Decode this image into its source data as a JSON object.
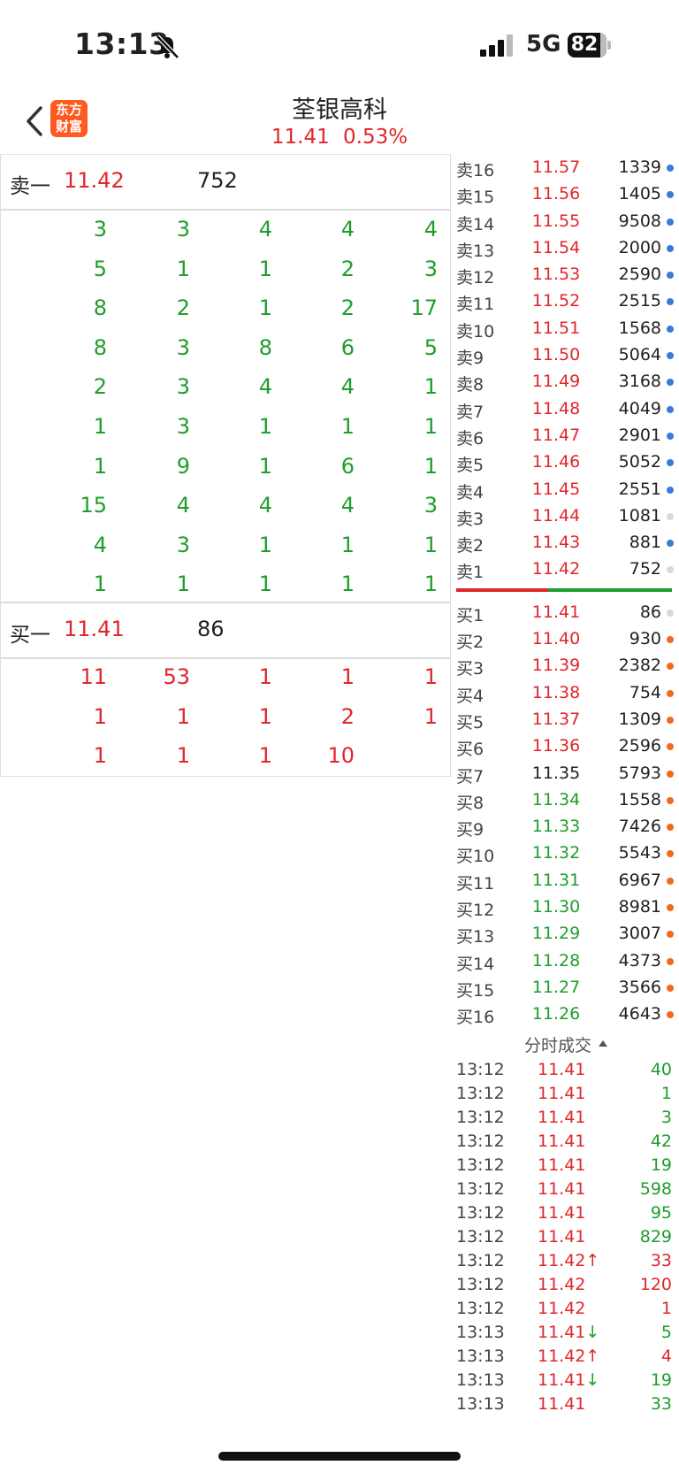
{
  "status_bar": {
    "time": "13:13",
    "network": "5G",
    "battery": "82"
  },
  "header": {
    "logo_text": "东方财富",
    "title": "荃银高科",
    "price": "11.41",
    "change": "0.53%"
  },
  "left_panel": {
    "sell1": {
      "label": "卖一",
      "price": "11.42",
      "volume": "752"
    },
    "sell_queue": [
      [
        "3",
        "3",
        "4",
        "4",
        "4"
      ],
      [
        "5",
        "1",
        "1",
        "2",
        "3"
      ],
      [
        "8",
        "2",
        "1",
        "2",
        "17"
      ],
      [
        "8",
        "3",
        "8",
        "6",
        "5"
      ],
      [
        "2",
        "3",
        "4",
        "4",
        "1"
      ],
      [
        "1",
        "3",
        "1",
        "1",
        "1"
      ],
      [
        "1",
        "9",
        "1",
        "6",
        "1"
      ],
      [
        "15",
        "4",
        "4",
        "4",
        "3"
      ],
      [
        "4",
        "3",
        "1",
        "1",
        "1"
      ],
      [
        "1",
        "1",
        "1",
        "1",
        "1"
      ]
    ],
    "buy1": {
      "label": "买一",
      "price": "11.41",
      "volume": "86"
    },
    "buy_queue": [
      [
        "11",
        "53",
        "1",
        "1",
        "1"
      ],
      [
        "1",
        "1",
        "1",
        "2",
        "1"
      ],
      [
        "1",
        "1",
        "1",
        "10",
        ""
      ]
    ]
  },
  "order_book": {
    "colors": {
      "red": "#e0262b",
      "green": "#1f9e2c",
      "dark": "#222222",
      "dot_blue": "#3a7bd5",
      "dot_gray": "#d9d9d9",
      "dot_orange": "#f06a1e"
    },
    "asks": [
      {
        "label": "卖16",
        "price": "11.57",
        "volume": "1339",
        "dot": "blue"
      },
      {
        "label": "卖15",
        "price": "11.56",
        "volume": "1405",
        "dot": "blue"
      },
      {
        "label": "卖14",
        "price": "11.55",
        "volume": "9508",
        "dot": "blue"
      },
      {
        "label": "卖13",
        "price": "11.54",
        "volume": "2000",
        "dot": "blue"
      },
      {
        "label": "卖12",
        "price": "11.53",
        "volume": "2590",
        "dot": "blue"
      },
      {
        "label": "卖11",
        "price": "11.52",
        "volume": "2515",
        "dot": "blue"
      },
      {
        "label": "卖10",
        "price": "11.51",
        "volume": "1568",
        "dot": "blue"
      },
      {
        "label": "卖9",
        "price": "11.50",
        "volume": "5064",
        "dot": "blue"
      },
      {
        "label": "卖8",
        "price": "11.49",
        "volume": "3168",
        "dot": "blue"
      },
      {
        "label": "卖7",
        "price": "11.48",
        "volume": "4049",
        "dot": "blue"
      },
      {
        "label": "卖6",
        "price": "11.47",
        "volume": "2901",
        "dot": "blue"
      },
      {
        "label": "卖5",
        "price": "11.46",
        "volume": "5052",
        "dot": "blue"
      },
      {
        "label": "卖4",
        "price": "11.45",
        "volume": "2551",
        "dot": "blue"
      },
      {
        "label": "卖3",
        "price": "11.44",
        "volume": "1081",
        "dot": "gray"
      },
      {
        "label": "卖2",
        "price": "11.43",
        "volume": "881",
        "dot": "blue"
      },
      {
        "label": "卖1",
        "price": "11.42",
        "volume": "752",
        "dot": "gray"
      }
    ],
    "bids": [
      {
        "label": "买1",
        "price": "11.41",
        "volume": "86",
        "dot": "gray",
        "color": "red"
      },
      {
        "label": "买2",
        "price": "11.40",
        "volume": "930",
        "dot": "orange",
        "color": "red"
      },
      {
        "label": "买3",
        "price": "11.39",
        "volume": "2382",
        "dot": "orange",
        "color": "red"
      },
      {
        "label": "买4",
        "price": "11.38",
        "volume": "754",
        "dot": "orange",
        "color": "red"
      },
      {
        "label": "买5",
        "price": "11.37",
        "volume": "1309",
        "dot": "orange",
        "color": "red"
      },
      {
        "label": "买6",
        "price": "11.36",
        "volume": "2596",
        "dot": "orange",
        "color": "red"
      },
      {
        "label": "买7",
        "price": "11.35",
        "volume": "5793",
        "dot": "orange",
        "color": "dark"
      },
      {
        "label": "买8",
        "price": "11.34",
        "volume": "1558",
        "dot": "orange",
        "color": "green"
      },
      {
        "label": "买9",
        "price": "11.33",
        "volume": "7426",
        "dot": "orange",
        "color": "green"
      },
      {
        "label": "买10",
        "price": "11.32",
        "volume": "5543",
        "dot": "orange",
        "color": "green"
      },
      {
        "label": "买11",
        "price": "11.31",
        "volume": "6967",
        "dot": "orange",
        "color": "green"
      },
      {
        "label": "买12",
        "price": "11.30",
        "volume": "8981",
        "dot": "orange",
        "color": "green"
      },
      {
        "label": "买13",
        "price": "11.29",
        "volume": "3007",
        "dot": "orange",
        "color": "green"
      },
      {
        "label": "买14",
        "price": "11.28",
        "volume": "4373",
        "dot": "orange",
        "color": "green"
      },
      {
        "label": "买15",
        "price": "11.27",
        "volume": "3566",
        "dot": "orange",
        "color": "green"
      },
      {
        "label": "买16",
        "price": "11.26",
        "volume": "4643",
        "dot": "orange",
        "color": "green"
      }
    ]
  },
  "ticks": {
    "title": "分时成交",
    "rows": [
      {
        "time": "13:12",
        "price": "11.41",
        "volume": "40",
        "vcolor": "green"
      },
      {
        "time": "13:12",
        "price": "11.41",
        "volume": "1",
        "vcolor": "green"
      },
      {
        "time": "13:12",
        "price": "11.41",
        "volume": "3",
        "vcolor": "green"
      },
      {
        "time": "13:12",
        "price": "11.41",
        "volume": "42",
        "vcolor": "green"
      },
      {
        "time": "13:12",
        "price": "11.41",
        "volume": "19",
        "vcolor": "green"
      },
      {
        "time": "13:12",
        "price": "11.41",
        "volume": "598",
        "vcolor": "green"
      },
      {
        "time": "13:12",
        "price": "11.41",
        "volume": "95",
        "vcolor": "green"
      },
      {
        "time": "13:12",
        "price": "11.41",
        "volume": "829",
        "vcolor": "green"
      },
      {
        "time": "13:12",
        "price": "11.42↑",
        "volume": "33",
        "vcolor": "red"
      },
      {
        "time": "13:12",
        "price": "11.42",
        "volume": "120",
        "vcolor": "red"
      },
      {
        "time": "13:12",
        "price": "11.42",
        "volume": "1",
        "vcolor": "red"
      },
      {
        "time": "13:13",
        "price": "11.41↓",
        "volume": "5",
        "vcolor": "green"
      },
      {
        "time": "13:13",
        "price": "11.42↑",
        "volume": "4",
        "vcolor": "red"
      },
      {
        "time": "13:13",
        "price": "11.41↓",
        "volume": "19",
        "vcolor": "green"
      },
      {
        "time": "13:13",
        "price": "11.41",
        "volume": "33",
        "vcolor": "green"
      }
    ]
  }
}
